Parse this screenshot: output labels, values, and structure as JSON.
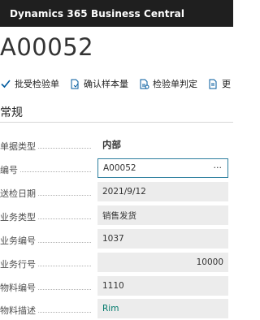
{
  "app": {
    "title": "Dynamics 365 Business Central"
  },
  "page": {
    "title": "A00052"
  },
  "actions": [
    {
      "label": "批受检验单",
      "icon": "checkmark-icon"
    },
    {
      "label": "确认样本量",
      "icon": "document-icon"
    },
    {
      "label": "检验单判定",
      "icon": "document-check-icon"
    },
    {
      "label": "更",
      "icon": "document-icon"
    }
  ],
  "section": {
    "title": "常规"
  },
  "fields": [
    {
      "label": "单据类型",
      "value": "内部"
    },
    {
      "label": "编号",
      "value": "A00052",
      "more": "···"
    },
    {
      "label": "送检日期",
      "value": "2021/9/12"
    },
    {
      "label": "业务类型",
      "value": "销售发货"
    },
    {
      "label": "业务编号",
      "value": "1037"
    },
    {
      "label": "业务行号",
      "value": "10000"
    },
    {
      "label": "物料编号",
      "value": "1110"
    },
    {
      "label": "物料描述",
      "value": "Rim"
    }
  ],
  "colors": {
    "topbar": "#1f1f1f",
    "accent": "#2d7f9e",
    "link": "#00796b",
    "field_bg": "#ececec"
  }
}
